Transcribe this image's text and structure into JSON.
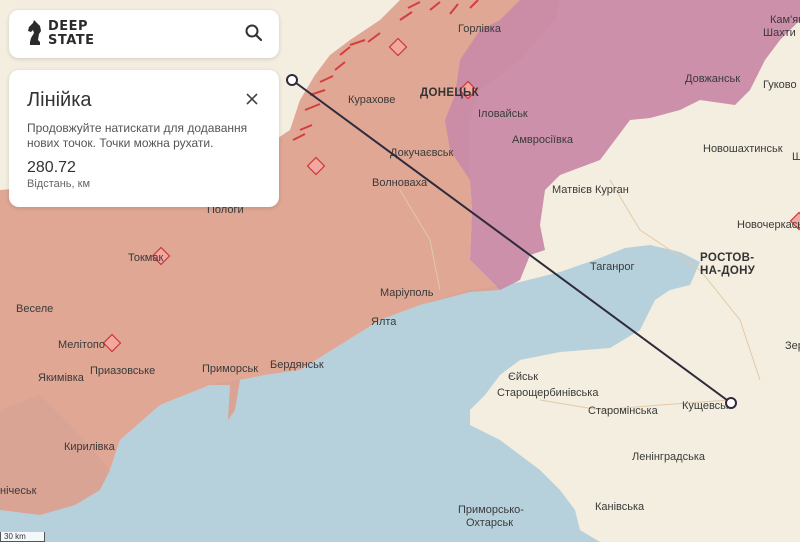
{
  "app": {
    "logo_text_line1": "DEEP",
    "logo_text_line2": "STATE",
    "search_icon": "search-icon",
    "logo_icon": "chess-knight-icon"
  },
  "ruler": {
    "title": "Лінійка",
    "hint": "Продовжуйте натискати для додавання нових точок. Точки можна рухати.",
    "distance": "280.72",
    "distance_label": "Відстань, км",
    "close_icon": "close-icon"
  },
  "scale": {
    "label": "30 km"
  },
  "colors": {
    "occupied": "#dd9f8c",
    "occupied_pre2022": "#c98aa6",
    "land": "#f3eedf",
    "sea": "#b7d1dc",
    "ruler_line": "#2f2b3c"
  },
  "places": [
    {
      "id": "horlivka",
      "label": "Горлівка"
    },
    {
      "id": "kurakhove",
      "label": "Курахове"
    },
    {
      "id": "donetsk",
      "label": "ДОНЕЦЬК"
    },
    {
      "id": "ilovaisk",
      "label": "Іловайськ"
    },
    {
      "id": "amvrosiivka",
      "label": "Амвросіївка"
    },
    {
      "id": "dovzhansk",
      "label": "Довжанськ"
    },
    {
      "id": "hukovo",
      "label": "Гуково"
    },
    {
      "id": "kamianskyi",
      "label": "Кам'янськ-"
    },
    {
      "id": "shakhty",
      "label": "Шахти"
    },
    {
      "id": "novoshakhtynsk",
      "label": "Новошахтинськ"
    },
    {
      "id": "dokuchaievsk",
      "label": "Докучаєвськ"
    },
    {
      "id": "matviiv_kurhan",
      "label": "Матвієв Курган"
    },
    {
      "id": "volnovakha",
      "label": "Волноваха"
    },
    {
      "id": "novocherkassk",
      "label": "Новочеркаськ"
    },
    {
      "id": "polohy",
      "label": "Пологи"
    },
    {
      "id": "rostov1",
      "label": "РОСТОВ-"
    },
    {
      "id": "rostov2",
      "label": "НА-ДОНУ"
    },
    {
      "id": "tokmak",
      "label": "Токмак"
    },
    {
      "id": "tahanrih",
      "label": "Таганрог"
    },
    {
      "id": "mariupol",
      "label": "Маріуполь"
    },
    {
      "id": "vesele",
      "label": "Веселе"
    },
    {
      "id": "yalta",
      "label": "Ялта"
    },
    {
      "id": "zernohrad",
      "label": "Зер"
    },
    {
      "id": "melitopol",
      "label": "Мелітопо"
    },
    {
      "id": "prymorsk",
      "label": "Приморськ"
    },
    {
      "id": "berdiansk",
      "label": "Бердянськ"
    },
    {
      "id": "yakymivka",
      "label": "Якимівка"
    },
    {
      "id": "pryazovske",
      "label": "Приазовське"
    },
    {
      "id": "yeisk",
      "label": "Єйськ"
    },
    {
      "id": "starotsherbynivska",
      "label": "Старощербинівська"
    },
    {
      "id": "starominska",
      "label": "Старомінська"
    },
    {
      "id": "kushchevska",
      "label": "Кущевськ"
    },
    {
      "id": "kyrylivka",
      "label": "Кирилівка"
    },
    {
      "id": "leninhradska",
      "label": "Ленінградська"
    },
    {
      "id": "henichesk",
      "label": "нічеськ"
    },
    {
      "id": "prymorsko1",
      "label": "Приморсько-"
    },
    {
      "id": "prymorsko2",
      "label": "Охтарськ"
    },
    {
      "id": "kanivska",
      "label": "Канівська"
    },
    {
      "id": "shakhtarsk_prefix",
      "label": "Ш"
    }
  ]
}
